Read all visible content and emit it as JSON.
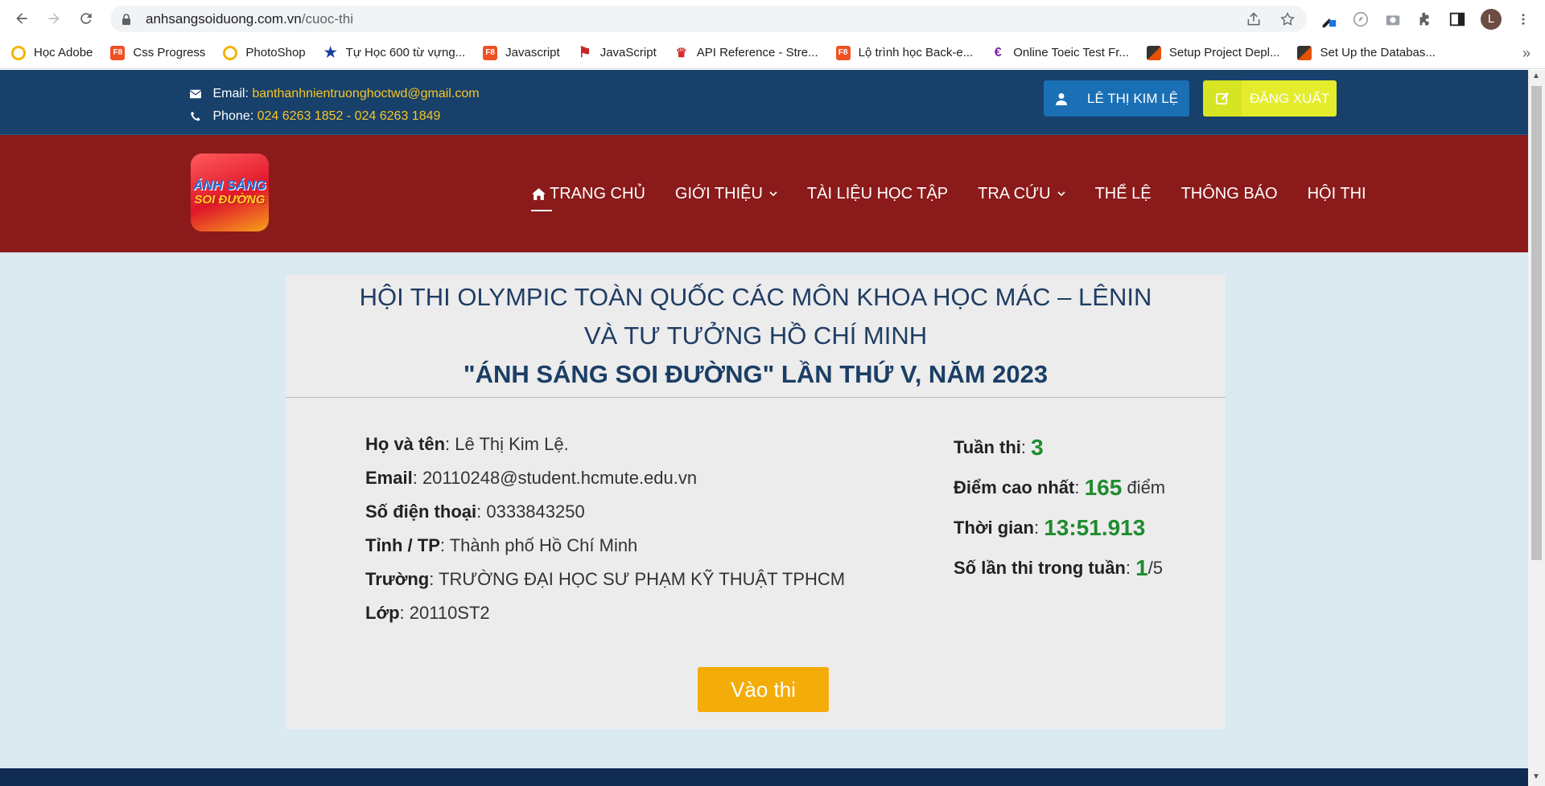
{
  "browser": {
    "url_host": "anhsangsoiduong.com.vn",
    "url_path": "/cuoc-thi",
    "profile_initial": "L",
    "bookmarks": [
      {
        "label": "Học Adobe",
        "icon": "adobe-icon",
        "color": "#f4b400"
      },
      {
        "label": "Css Progress",
        "icon": "f8-icon",
        "color": "#f05123"
      },
      {
        "label": "PhotoShop",
        "icon": "adobe-icon",
        "color": "#f4b400"
      },
      {
        "label": "Tự Học 600 từ vựng...",
        "icon": "star-icon",
        "color": "#1a3e9c"
      },
      {
        "label": "Javascript",
        "icon": "f8-icon",
        "color": "#f05123"
      },
      {
        "label": "JavaScript",
        "icon": "flag-icon",
        "color": "#c62828"
      },
      {
        "label": "API Reference - Stre...",
        "icon": "crown-icon",
        "color": "#d32f2f"
      },
      {
        "label": "Lộ trình học Back-e...",
        "icon": "f8-icon",
        "color": "#f05123"
      },
      {
        "label": "Online Toeic Test Fr...",
        "icon": "toeic-icon",
        "color": "#7b1fa2"
      },
      {
        "label": "Setup Project Depl...",
        "icon": "notion-icon",
        "color": "#e65100"
      },
      {
        "label": "Set Up the Databas...",
        "icon": "notion-icon",
        "color": "#e65100"
      }
    ],
    "more": "»"
  },
  "topbar": {
    "email_label": "Email:",
    "email_value": "banthanhnientruonghoctwd@gmail.com",
    "phone_label": "Phone:",
    "phone_value": "024 6263 1852 - 024 6263 1849",
    "user_button": "LÊ THỊ KIM LỆ",
    "logout_button": "ĐĂNG XUẤT"
  },
  "logo": {
    "line1": "ÁNH SÁNG",
    "line2": "SOI ĐƯỜNG"
  },
  "menu": {
    "home": "TRANG CHỦ",
    "about": "GIỚI THIỆU",
    "docs": "TÀI LIỆU HỌC TẬP",
    "lookup": "TRA CỨU",
    "rules": "THỂ LỆ",
    "notice": "THÔNG BÁO",
    "contest": "HỘI THI"
  },
  "card": {
    "title_line1": "HỘI THI OLYMPIC TOÀN QUỐC CÁC MÔN KHOA HỌC MÁC – LÊNIN",
    "title_line2": "VÀ TƯ TƯỞNG HỒ CHÍ MINH",
    "title_line3": "\"ÁNH SÁNG SOI ĐƯỜNG\" LẦN THỨ V, NĂM 2023",
    "profile": {
      "name_label": "Họ và tên",
      "name": "Lê Thị Kim Lệ.",
      "email_label": "Email",
      "email": "20110248@student.hcmute.edu.vn",
      "phone_label": "Số điện thoại",
      "phone": "0333843250",
      "city_label": "Tỉnh / TP",
      "city": "Thành phố Hồ Chí Minh",
      "school_label": "Trường",
      "school": "TRƯỜNG ĐẠI HỌC SƯ PHẠM KỸ THUẬT TPHCM",
      "class_label": "Lớp",
      "class": "20110ST2"
    },
    "stats": {
      "week_label": "Tuần thi",
      "week": "3",
      "best_label": "Điểm cao nhất",
      "best": "165",
      "best_unit": "điểm",
      "time_label": "Thời gian",
      "time": "13:51.913",
      "attempts_label": "Số lần thi trong tuần",
      "attempts": "1",
      "attempts_max": "/5"
    },
    "enter_button": "Vào thi"
  }
}
